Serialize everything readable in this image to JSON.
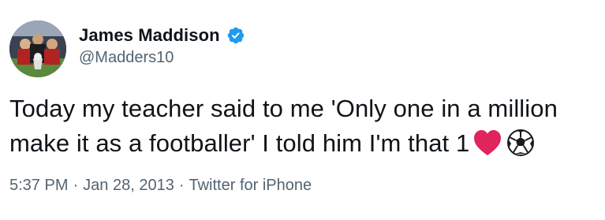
{
  "user": {
    "name": "James Maddison",
    "handle": "@Madders10",
    "verified": true
  },
  "tweet": {
    "line1": "Today my teacher said to me 'Only one in a million",
    "line2": "make it as a footballer' I told him I'm that 1",
    "emojis": [
      "heart-emoji",
      "soccer-ball-emoji"
    ]
  },
  "meta": {
    "time": "5:37 PM",
    "separator": "·",
    "date": "Jan 28, 2013",
    "source": "Twitter for iPhone"
  },
  "colors": {
    "text": "#0f1419",
    "secondary": "#536471",
    "verified": "#1d9bf0",
    "heart": "#e0245e"
  }
}
